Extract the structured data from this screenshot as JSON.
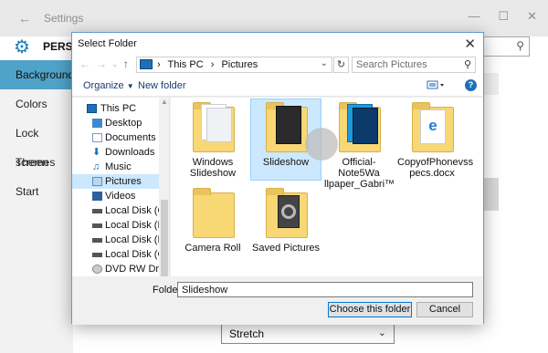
{
  "settings": {
    "window_title": "Settings",
    "header_title": "PERSO",
    "nav_items": [
      {
        "label": "Background",
        "selected": true
      },
      {
        "label": "Colors"
      },
      {
        "label": "Lock screen"
      },
      {
        "label": "Themes"
      },
      {
        "label": "Start"
      }
    ],
    "fit_value": "Stretch",
    "accent_color": "#4fa3c9"
  },
  "dialog": {
    "title": "Select Folder",
    "breadcrumb": [
      "This PC",
      "Pictures"
    ],
    "search_placeholder": "Search Pictures",
    "toolbar": {
      "organize_label": "Organize",
      "new_folder_label": "New folder"
    },
    "tree_items": [
      {
        "label": "This PC",
        "icon": "computer-icon",
        "indent": 0
      },
      {
        "label": "Desktop",
        "icon": "desktop-icon",
        "indent": 1
      },
      {
        "label": "Documents",
        "icon": "documents-icon",
        "indent": 1
      },
      {
        "label": "Downloads",
        "icon": "downloads-icon",
        "indent": 1
      },
      {
        "label": "Music",
        "icon": "music-icon",
        "indent": 1
      },
      {
        "label": "Pictures",
        "icon": "pictures-icon",
        "indent": 1,
        "selected": true
      },
      {
        "label": "Videos",
        "icon": "videos-icon",
        "indent": 1
      },
      {
        "label": "Local Disk (C:)",
        "icon": "disk-icon",
        "indent": 1
      },
      {
        "label": "Local Disk (E:)",
        "icon": "disk-icon",
        "indent": 1
      },
      {
        "label": "Local Disk (F:)",
        "icon": "disk-icon",
        "indent": 1
      },
      {
        "label": "Local Disk (G:)",
        "icon": "disk-icon",
        "indent": 1
      },
      {
        "label": "DVD RW Drive (H",
        "icon": "dvd-icon",
        "indent": 1
      }
    ],
    "files": [
      {
        "name": "Windows\nSlideshow",
        "type": "folder"
      },
      {
        "name": "Slideshow",
        "type": "folder",
        "selected": true
      },
      {
        "name": "Official-Note5Wa\nllpaper_Gabri™",
        "type": "folder"
      },
      {
        "name": "CopyofPhonevss\npecs.docx",
        "type": "document"
      },
      {
        "name": "Camera Roll",
        "type": "folder"
      },
      {
        "name": "Saved Pictures",
        "type": "folder"
      }
    ],
    "folder_label": "Folder:",
    "folder_value": "Slideshow",
    "choose_label": "Choose this folder",
    "cancel_label": "Cancel"
  }
}
